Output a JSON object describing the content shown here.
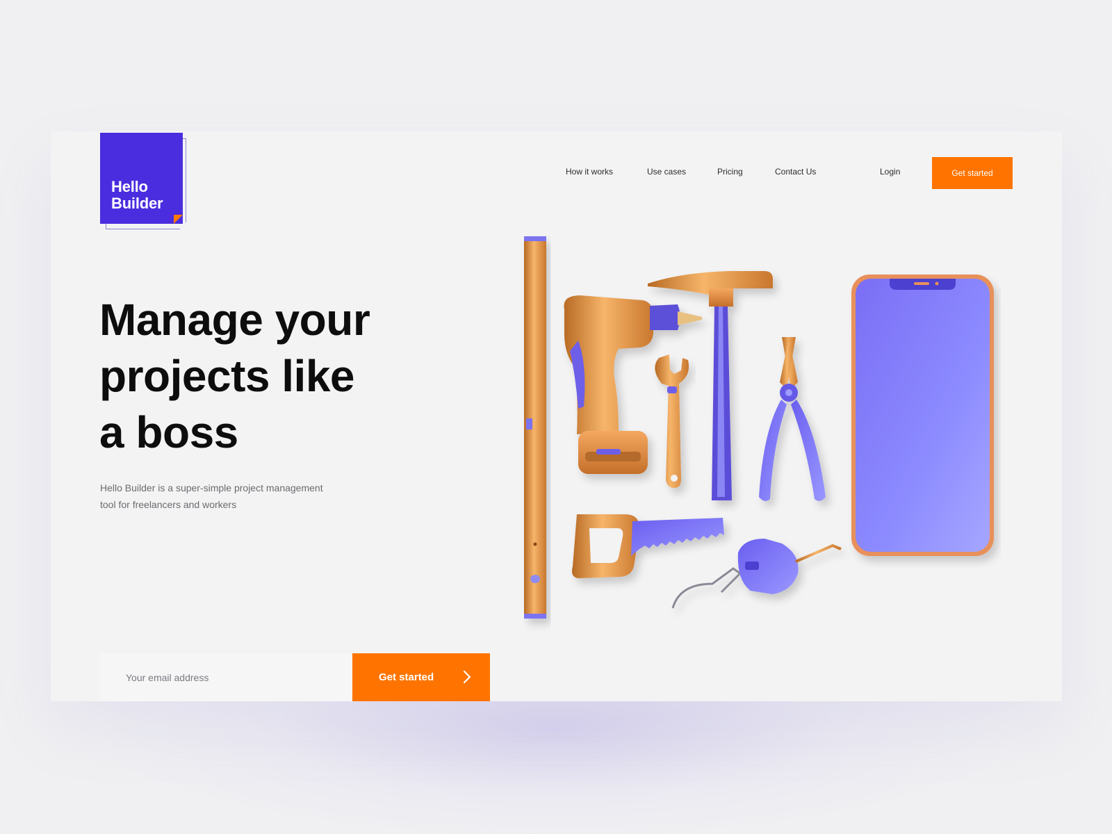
{
  "brand": {
    "logo_line1": "Hello",
    "logo_line2": "Builder",
    "primary_color": "#4a2ddf",
    "accent_color": "#ff7400"
  },
  "nav": {
    "items": [
      {
        "label": "How it works"
      },
      {
        "label": "Use cases"
      },
      {
        "label": "Pricing"
      },
      {
        "label": "Contact Us"
      }
    ],
    "login_label": "Login",
    "cta_label": "Get started"
  },
  "hero": {
    "headline_line1": "Manage your",
    "headline_line2": "projects like",
    "headline_line3": "a boss",
    "subtext": "Hello Builder is a super-simple project management tool for freelancers and workers",
    "email_placeholder": "Your email address",
    "cta_label": "Get started",
    "cta_icon": "chevron-right-icon"
  },
  "illustration": {
    "items": [
      "spirit-level",
      "power-drill",
      "wrench",
      "hammer",
      "pliers",
      "smartphone",
      "hand-saw",
      "tape-measure"
    ]
  }
}
